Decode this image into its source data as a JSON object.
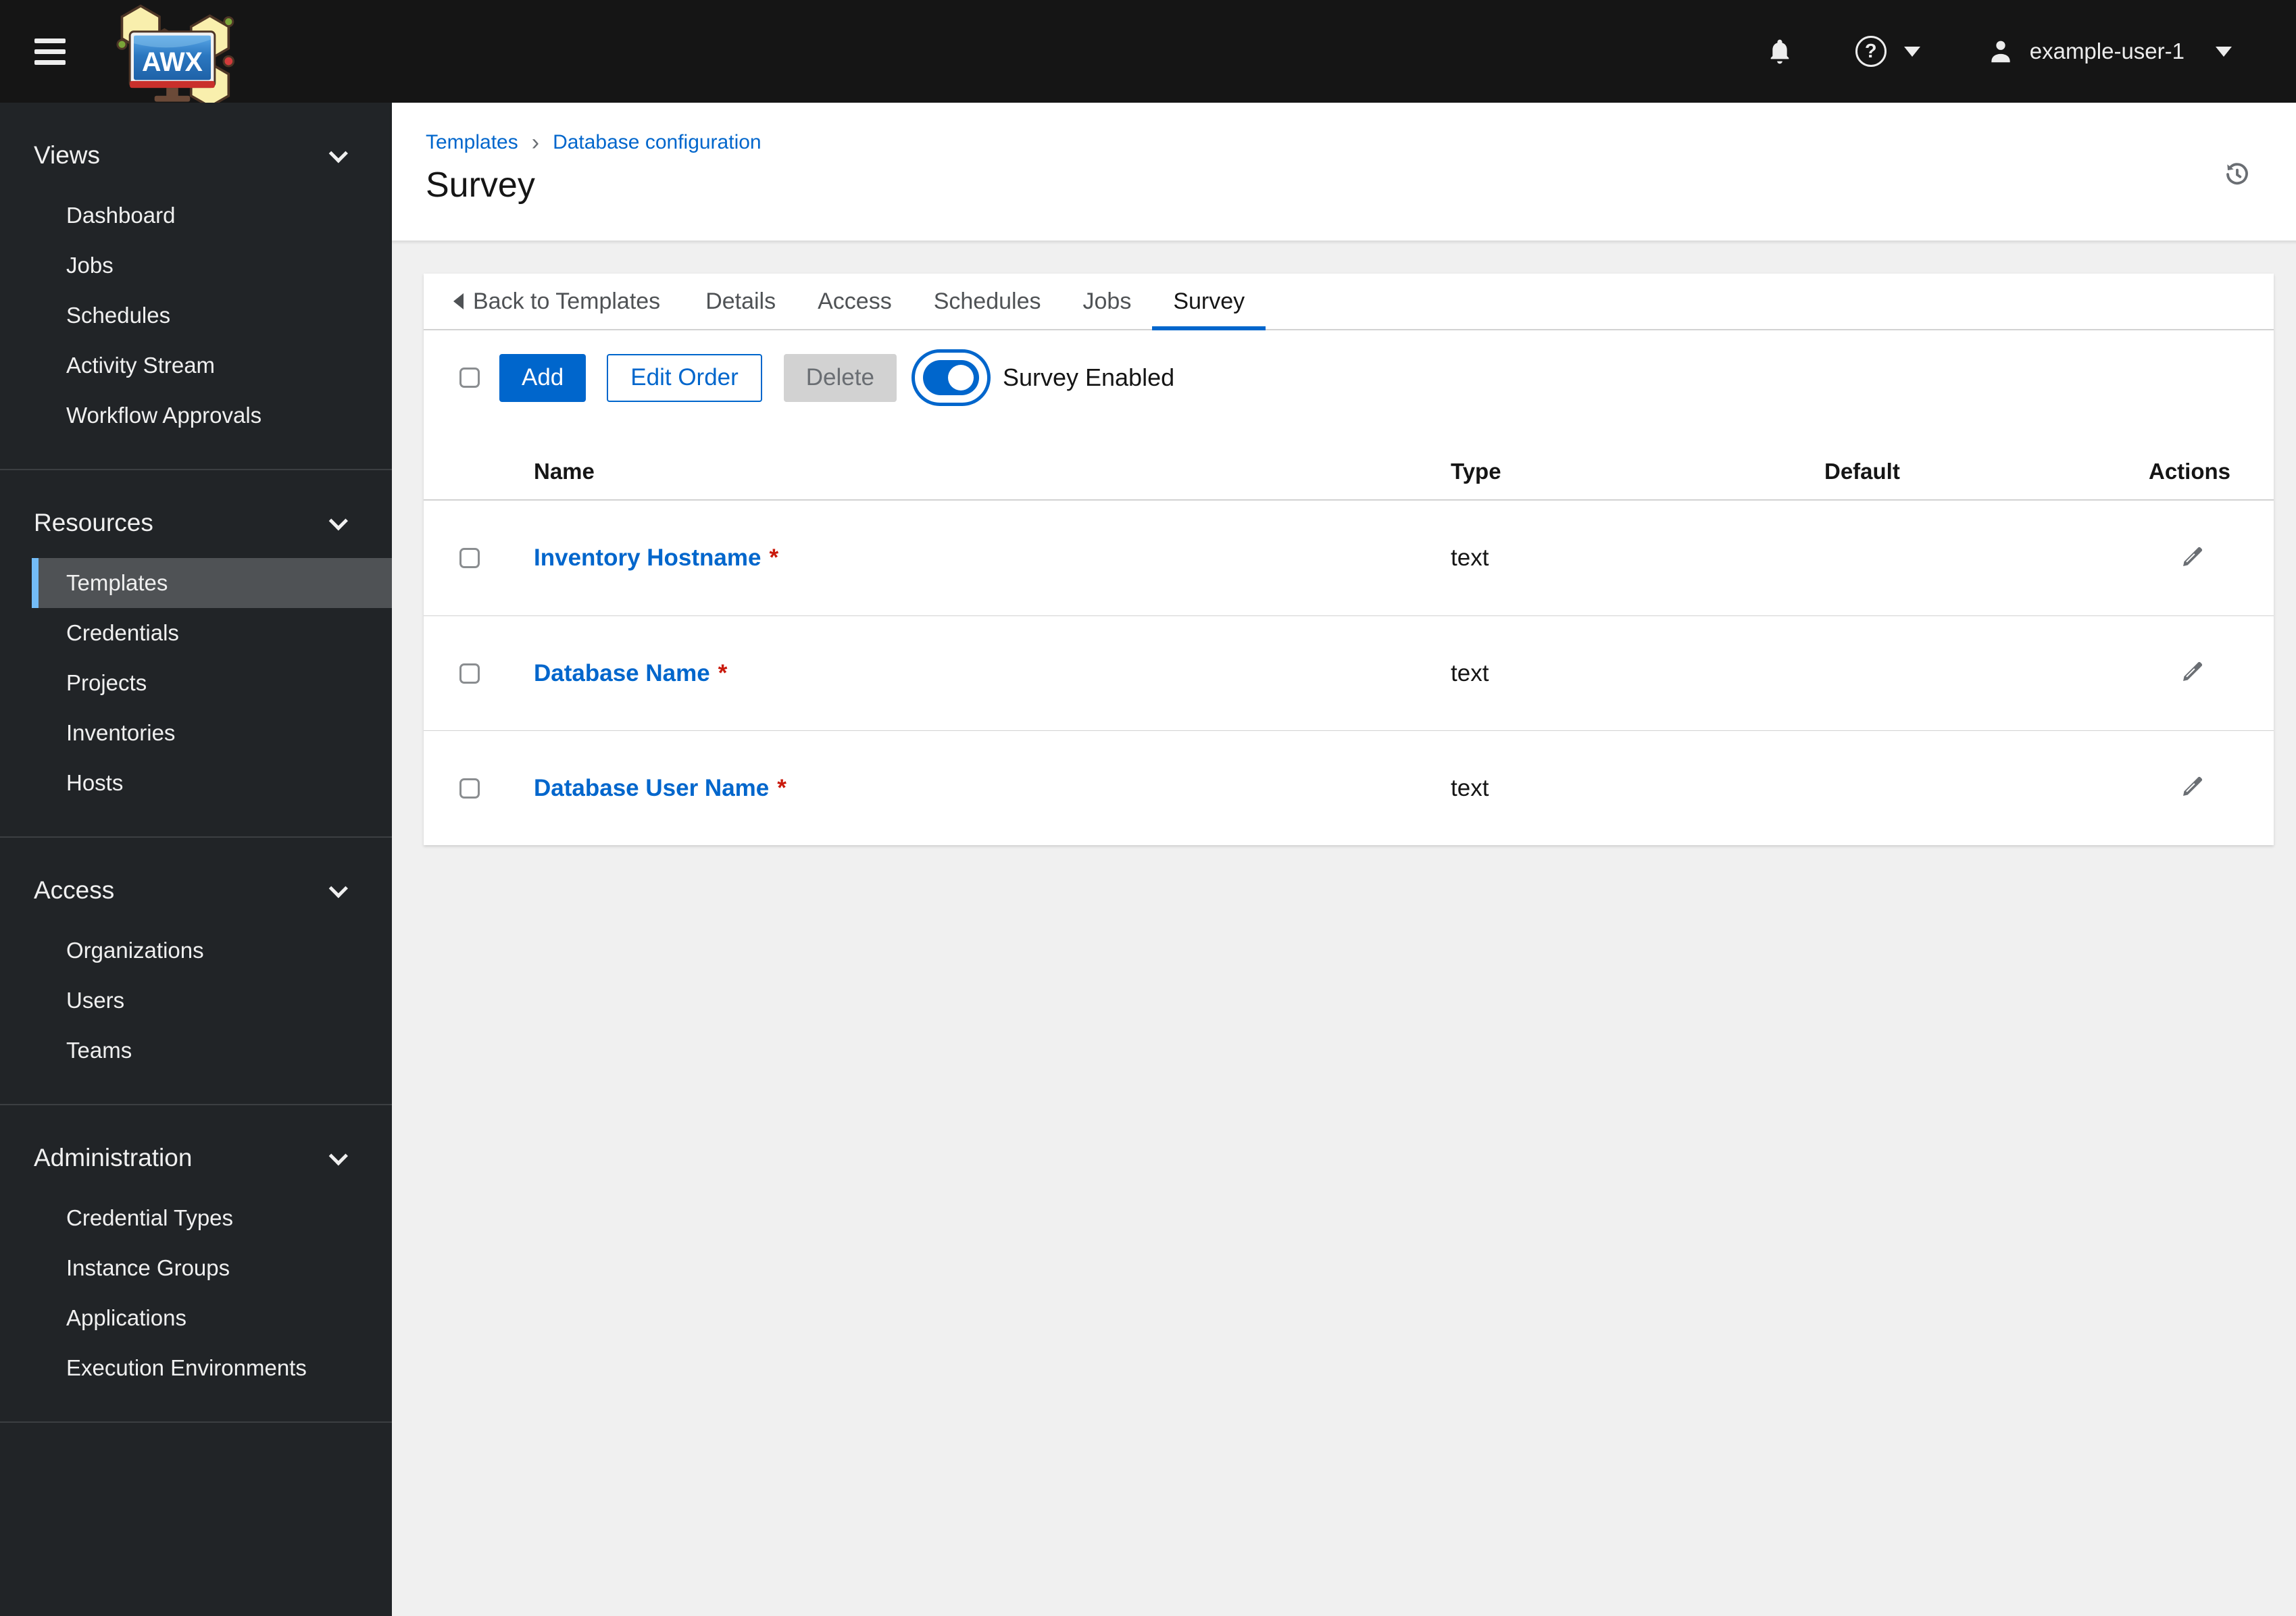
{
  "masthead": {
    "logo_text": "AWX",
    "help_glyph": "?",
    "user": "example-user-1"
  },
  "sidebar": {
    "sections": [
      {
        "label": "Views",
        "items": [
          "Dashboard",
          "Jobs",
          "Schedules",
          "Activity Stream",
          "Workflow Approvals"
        ]
      },
      {
        "label": "Resources",
        "items": [
          "Templates",
          "Credentials",
          "Projects",
          "Inventories",
          "Hosts"
        ],
        "selected_item": "Templates"
      },
      {
        "label": "Access",
        "items": [
          "Organizations",
          "Users",
          "Teams"
        ]
      },
      {
        "label": "Administration",
        "items": [
          "Credential Types",
          "Instance Groups",
          "Applications",
          "Execution Environments"
        ]
      }
    ]
  },
  "breadcrumb": {
    "separator": "›",
    "items": [
      "Templates",
      "Database configuration"
    ]
  },
  "page": {
    "title": "Survey"
  },
  "tabs": {
    "back": "Back to Templates",
    "items": [
      "Details",
      "Access",
      "Schedules",
      "Jobs",
      "Survey"
    ],
    "active": "Survey"
  },
  "toolbar": {
    "add": "Add",
    "edit_order": "Edit Order",
    "delete": "Delete",
    "toggle_label": "Survey Enabled",
    "toggle_on": true
  },
  "table": {
    "headers": [
      "Name",
      "Type",
      "Default",
      "Actions"
    ],
    "required_marker": "*",
    "rows": [
      {
        "name": "Inventory Hostname",
        "required": true,
        "type": "text",
        "default": ""
      },
      {
        "name": "Database Name",
        "required": true,
        "type": "text",
        "default": ""
      },
      {
        "name": "Database User Name",
        "required": true,
        "type": "text",
        "default": ""
      }
    ]
  },
  "colors": {
    "accent": "#0066cc",
    "masthead_bg": "#151515",
    "sidebar_bg": "#212427",
    "selected_item_bg": "#4f5255",
    "selected_item_border": "#73bcf7",
    "required": "#c9190b",
    "disabled_bg": "#d2d2d2",
    "muted_text": "#6a6e73",
    "page_bg": "#f0f0f0"
  }
}
